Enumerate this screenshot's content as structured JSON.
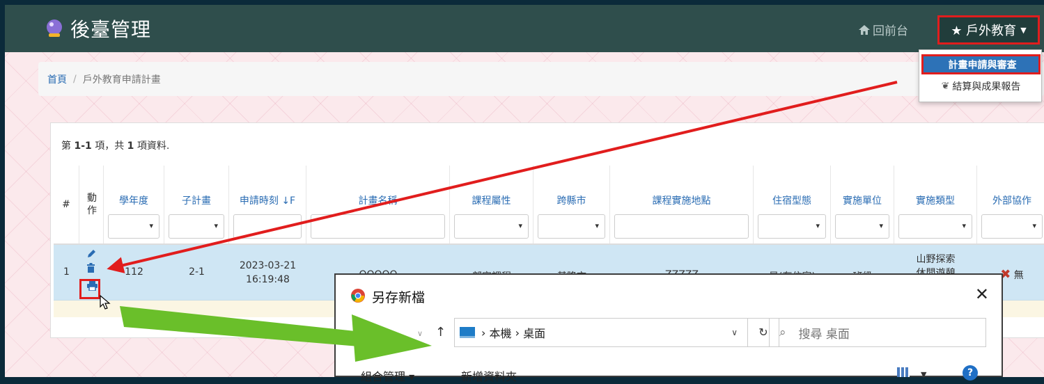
{
  "navbar": {
    "title": "後臺管理",
    "home_link": "回前台",
    "user_menu": "★ 戶外教育",
    "brand_icon": "crystal-ball-icon"
  },
  "dropdown": {
    "items": [
      {
        "label": "計畫申請與審查",
        "icon": "apple-icon",
        "active": true
      },
      {
        "label": "結算與成果報告",
        "icon": "sprout-icon",
        "active": false
      }
    ]
  },
  "breadcrumb": {
    "home": "首頁",
    "separator": "/",
    "current": "戶外教育申請計畫"
  },
  "summary": {
    "prefix": "第 ",
    "range": "1-1",
    "middle": " 項，共 ",
    "total": "1",
    "suffix": " 項資料."
  },
  "table": {
    "headers": [
      "#",
      "動作",
      "學年度",
      "子計畫",
      "申請時刻",
      "計畫名稱",
      "課程屬性",
      "跨縣市",
      "課程實施地點",
      "住宿型態",
      "實施單位",
      "實施類型",
      "外部協作"
    ],
    "sort_icon": "↓F",
    "row": {
      "num": "1",
      "year": "112",
      "subplan": "2-1",
      "date": "2023-03-21",
      "time": "16:19:48",
      "name": "QQQQQ",
      "course_type": "部定課程",
      "cross_county": "基隆市",
      "location": "ZZZZZ",
      "lodging": "是(有住宿)",
      "unit": "班級",
      "impl_type_1": "山野探索",
      "impl_type_2": "休閒遊憩",
      "external": "無"
    }
  },
  "dialog": {
    "title": "另存新檔",
    "breadcrumb_1": "本機",
    "breadcrumb_2": "桌面",
    "search_placeholder": "搜尋 桌面",
    "organize": "組合管理 ▾",
    "new_folder": "新增資料夾",
    "close": "✕"
  },
  "colors": {
    "navbar": "#2f4e4c",
    "highlight_red": "#e11d1d",
    "arrow_green": "#6abf2a",
    "row_selected": "#cfe6f4",
    "link_blue": "#2a6cb3"
  }
}
